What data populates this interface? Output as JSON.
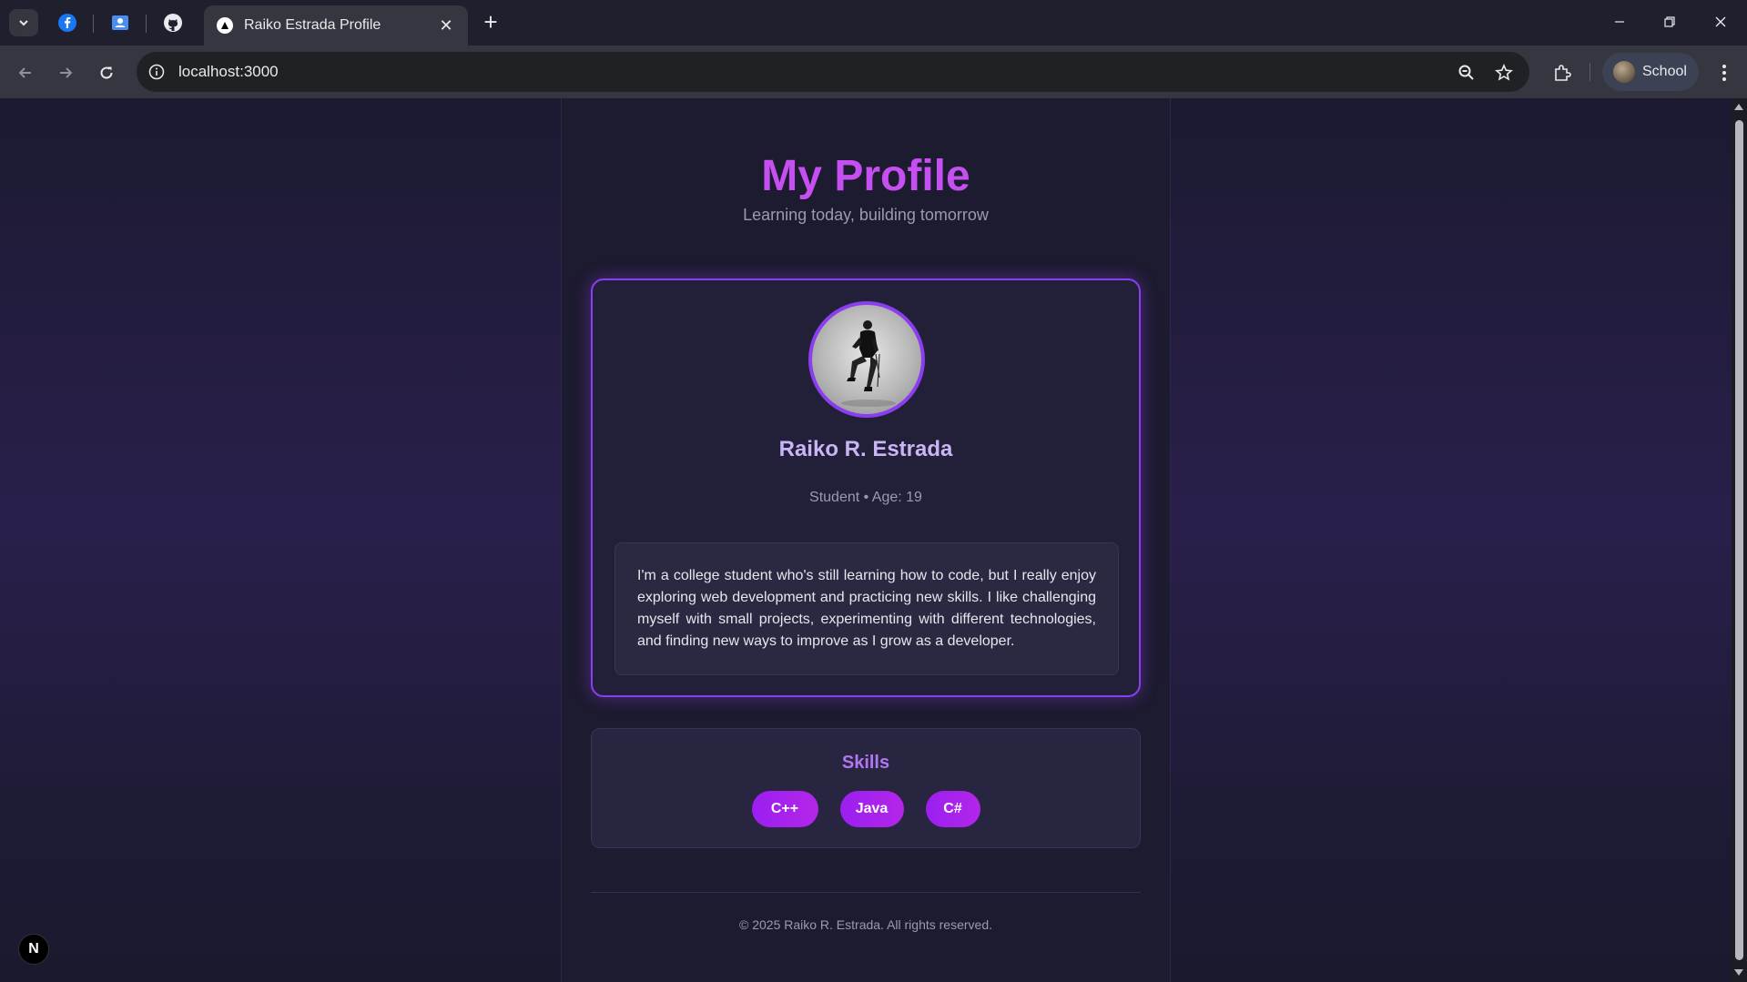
{
  "browser": {
    "tab_title": "Raiko Estrada Profile",
    "tab_close": "✕",
    "new_tab": "+",
    "url": "localhost:3000",
    "profile_name": "School",
    "pinned_tabs": [
      "facebook-icon",
      "contacts-icon",
      "github-icon"
    ],
    "colors": {
      "tabbar": "#1f1f2e",
      "toolbar": "#35363f",
      "omnibox": "#202124"
    }
  },
  "page": {
    "heading": "My Profile",
    "tagline": "Learning today, building tomorrow",
    "profile": {
      "name": "Raiko R. Estrada",
      "meta": "Student • Age: 19",
      "bio": "I'm a college student who's still learning how to code, but I really enjoy exploring web development and practicing new skills. I like challenging myself with small projects, experimenting with different technologies, and finding new ways to improve as I grow as a developer."
    },
    "skills": {
      "title": "Skills",
      "items": [
        "C++",
        "Java",
        "C#"
      ]
    },
    "footer": "© 2025 Raiko R. Estrada. All rights reserved.",
    "dev_badge": "N",
    "colors": {
      "accent": "#8b3df0",
      "heading": "#c54ff0",
      "chip": "#9b1ff0"
    }
  }
}
